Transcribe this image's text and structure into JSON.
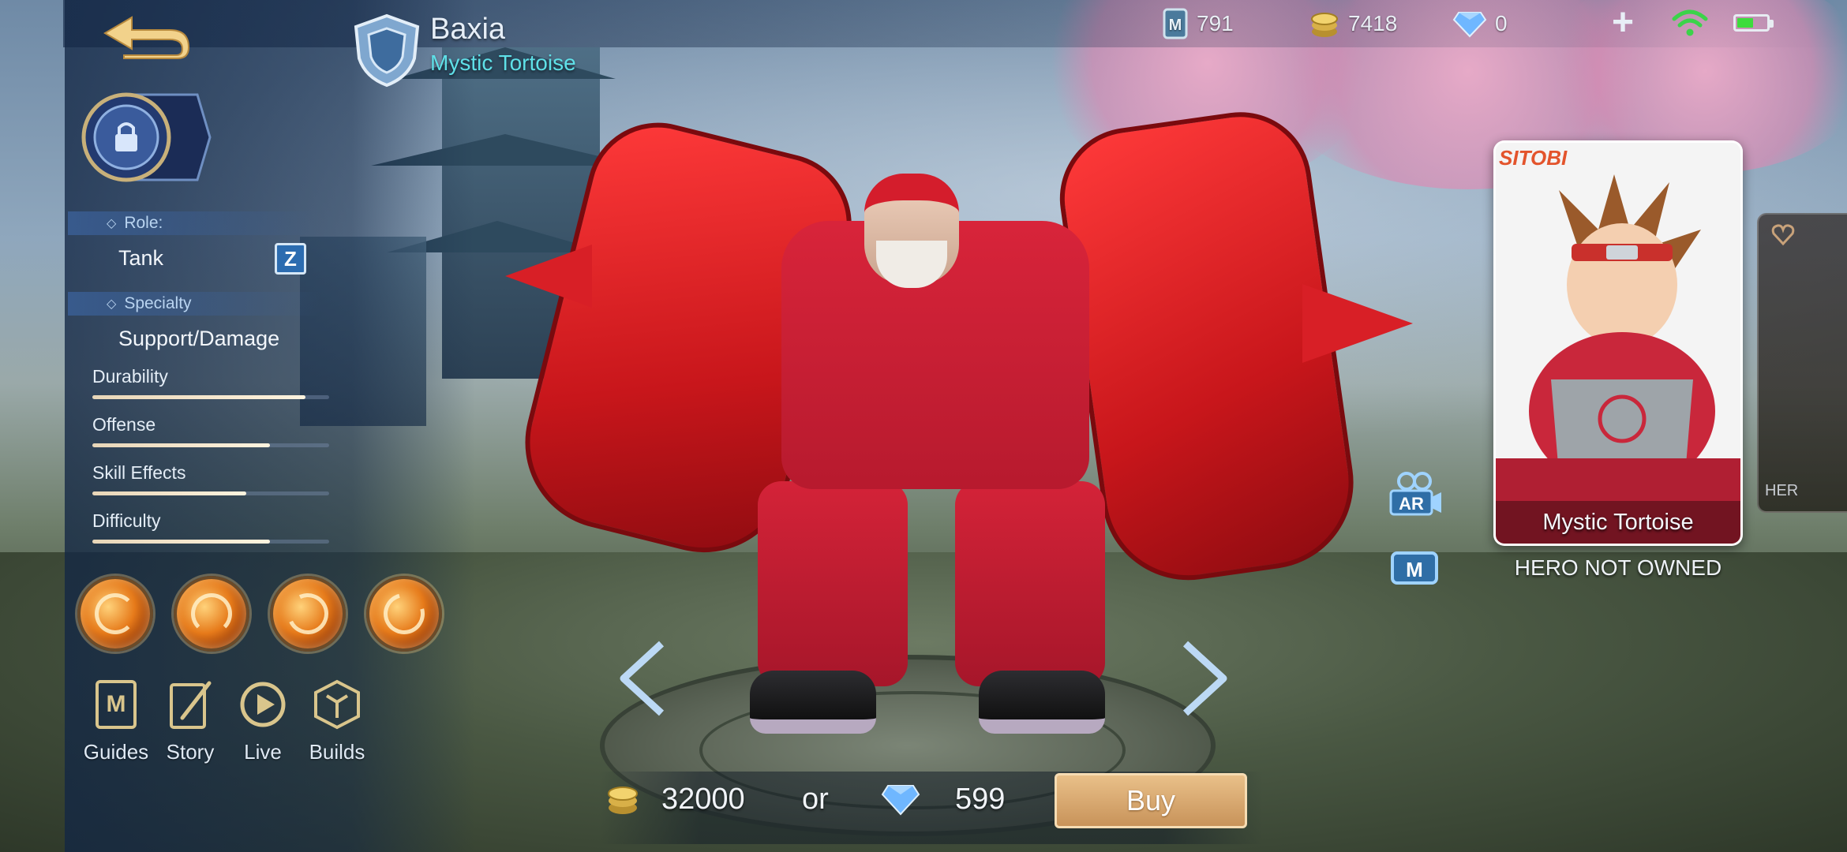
{
  "hero": {
    "name": "Baxia",
    "skin_name": "Mystic Tortoise"
  },
  "resources": {
    "tickets": "791",
    "battle_points": "7418",
    "diamonds": "0"
  },
  "info": {
    "role_label": "Role:",
    "role_value": "Tank",
    "specialty_label": "Specialty",
    "specialty_value": "Support/Damage",
    "stats": [
      {
        "label": "Durability",
        "value": 0.9
      },
      {
        "label": "Offense",
        "value": 0.75
      },
      {
        "label": "Skill Effects",
        "value": 0.65
      },
      {
        "label": "Difficulty",
        "value": 0.75
      }
    ]
  },
  "skills": [
    "passive-skill-icon",
    "skill-1-icon",
    "skill-2-icon",
    "ultimate-skill-icon"
  ],
  "menu": [
    {
      "label": "Guides",
      "icon": "guides-icon"
    },
    {
      "label": "Story",
      "icon": "story-icon"
    },
    {
      "label": "Live",
      "icon": "live-icon"
    },
    {
      "label": "Builds",
      "icon": "builds-icon"
    }
  ],
  "side_buttons": {
    "ar_label": "AR"
  },
  "skin_card": {
    "name": "Mystic Tortoise",
    "status": "HERO NOT OWNED",
    "next_card_text": "HER"
  },
  "purchase": {
    "bp_price": "32000",
    "or_text": "or",
    "diamond_price": "599",
    "buy_label": "Buy"
  },
  "colors": {
    "accent_cyan": "#5fe0e8",
    "buy_gold": "#d8a86c",
    "hero_red": "#d42338"
  }
}
